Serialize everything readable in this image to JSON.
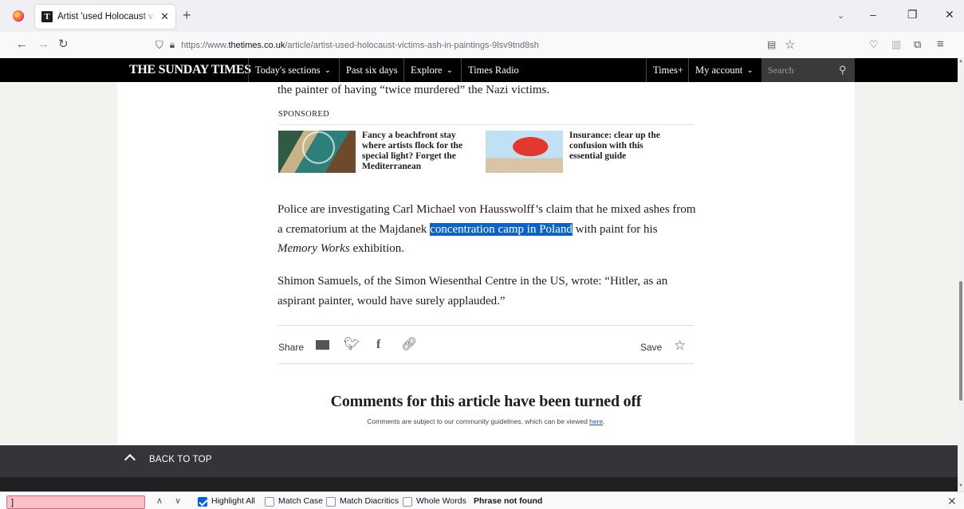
{
  "browser": {
    "tab_title": "Artist 'used Holocaust victims' ash in paintings",
    "tab_close": "✕",
    "new_tab": "+",
    "url_prefix": "https://www.",
    "url_host": "thetimes.co.uk",
    "url_path": "/article/artist-used-holocaust-victims-ash-in-paintings-9lsv9tnd8sh",
    "icons": [
      "firefox-icon",
      "list-all-tabs-icon",
      "minimize-icon",
      "restore-icon",
      "close-window-icon",
      "back-icon",
      "forward-icon",
      "reload-icon",
      "shield-icon",
      "lock-icon",
      "reader-view-icon",
      "bookmark-star-icon",
      "pocket-icon",
      "sidebar-icon",
      "extensions-icon",
      "menu-icon"
    ]
  },
  "masthead": {
    "logo": "THE SUNDAY TIMES",
    "nav": [
      "Today's sections",
      "Past six days",
      "Explore",
      "Times Radio",
      "Times+",
      "My account"
    ],
    "chevron": "⌄",
    "search_placeholder": "Search"
  },
  "article": {
    "clipped_line": "the painter of having “twice murdered” the Nazi victims.",
    "sponsored_label": "SPONSORED",
    "sponsored": [
      {
        "text": "Fancy a beachfront stay where artists flock for the special light? Forget the Mediterranean"
      },
      {
        "text": "Insurance: clear up the confusion with this essential guide"
      }
    ],
    "para1_before": "Police are investigating Carl Michael von Hausswolff’s claim that he mixed ashes from a crematorium at the Majdanek ",
    "para1_highlight": "concentration camp in Poland",
    "para1_mid": " with paint for his ",
    "para1_em": "Memory Works",
    "para1_after": " exhibition.",
    "para2": "Shimon Samuels, of the Simon Wiesenthal Centre in the US, wrote: “Hitler, as an aspirant painter, would have surely applauded.”",
    "share_label": "Share",
    "save_label": "Save",
    "comments_title": "Comments for this article have been turned off",
    "comments_note": "Comments are subject to our community guidelines, which can be viewed ",
    "comments_link": "here",
    "comments_end": ".",
    "back_to_top": "BACK TO TOP"
  },
  "findbar": {
    "value": "]",
    "options": [
      {
        "label": "Highlight All",
        "checked": true
      },
      {
        "label": "Match Case",
        "checked": false
      },
      {
        "label": "Match Diacritics",
        "checked": false
      },
      {
        "label": "Whole Words",
        "checked": false
      }
    ],
    "status": "Phrase not found"
  },
  "colors": {
    "highlight": "#0a64c8",
    "masthead": "#000000",
    "find_error": "#f9c0c8"
  }
}
